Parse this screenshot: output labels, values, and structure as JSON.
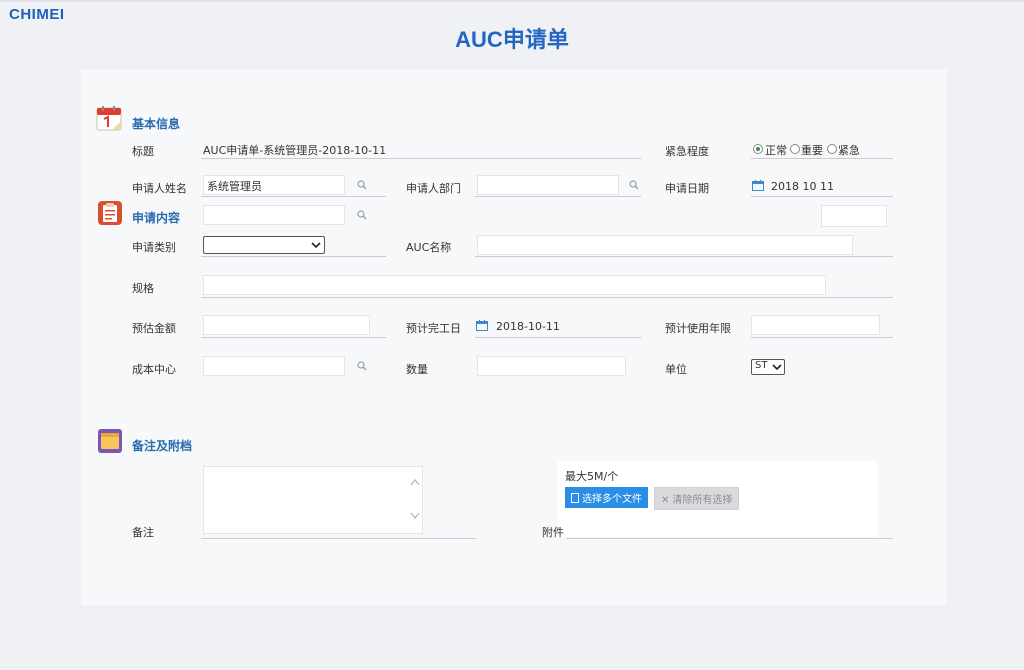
{
  "app": {
    "logo": "CHIMEI",
    "title": "AUC申请单"
  },
  "sections": {
    "basic": "基本信息",
    "content": "申请内容",
    "remarks": "备注及附档"
  },
  "fields": {
    "subject": {
      "label": "标题",
      "value": "AUC申请单-系统管理员-2018-10-11"
    },
    "urgency": {
      "label": "紧急程度",
      "options": [
        "正常",
        "重要",
        "紧急"
      ],
      "selected": "正常"
    },
    "applicant": {
      "label": "申请人姓名",
      "value": "系统管理员"
    },
    "department": {
      "label": "申请人部门",
      "value": ""
    },
    "apply_date": {
      "label": "申请日期",
      "value": "2018 10 11"
    },
    "category": {
      "label": "申请类别",
      "value": ""
    },
    "auc_name": {
      "label": "AUC名称",
      "value": ""
    },
    "spec": {
      "label": "规格",
      "value": ""
    },
    "estimate": {
      "label": "预估金额",
      "value": ""
    },
    "finish_date": {
      "label": "预计完工日",
      "value": "2018-10-11"
    },
    "life_years": {
      "label": "预计使用年限",
      "value": ""
    },
    "cost_center": {
      "label": "成本中心",
      "value": ""
    },
    "quantity": {
      "label": "数量",
      "value": ""
    },
    "unit": {
      "label": "单位",
      "value": "ST"
    },
    "remark": {
      "label": "备注",
      "value": ""
    },
    "attachment": {
      "label": "附件",
      "hint": "最大5M/个",
      "choose": "选择多个文件",
      "clear": "清除所有选择"
    }
  },
  "colors": {
    "brand": "#1e5fb8",
    "section": "#2a6ab0",
    "upload": "#2a8ee6"
  },
  "icons": {
    "basic": "calendar-icon",
    "content": "clipboard-icon",
    "remarks": "folder-icon"
  }
}
